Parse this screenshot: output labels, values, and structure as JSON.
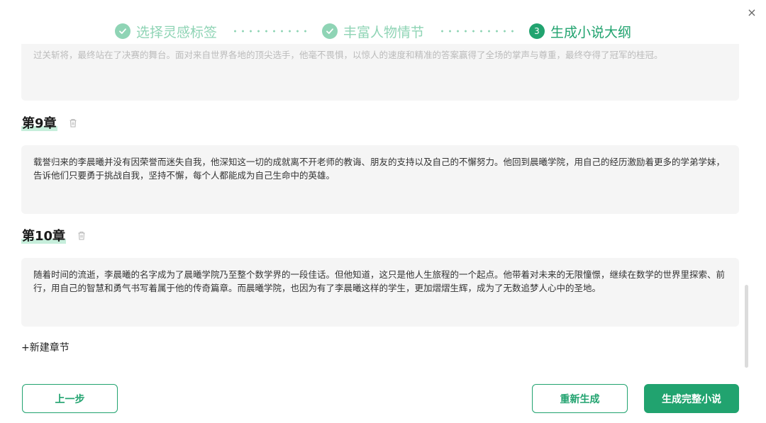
{
  "dialog": {
    "close_icon": "close-icon"
  },
  "steps": [
    {
      "label": "选择灵感标签",
      "state": "done",
      "icon": "check-circle-icon"
    },
    {
      "label": "丰富人物情节",
      "state": "done",
      "icon": "check-circle-icon"
    },
    {
      "number": "3",
      "label": "生成小说大纲",
      "state": "active"
    }
  ],
  "chapters": {
    "prev_text": "过关斩将，最终站在了决赛的舞台。面对来自世界各地的顶尖选手，他毫不畏惧，以惊人的速度和精准的答案赢得了全场的掌声与尊重，最终夺得了冠军的桂冠。",
    "items": [
      {
        "title": "第9章",
        "text": "载誉归来的李晨曦并没有因荣誉而迷失自我，他深知这一切的成就离不开老师的教诲、朋友的支持以及自己的不懈努力。他回到晨曦学院，用自己的经历激励着更多的学弟学妹，告诉他们只要勇于挑战自我，坚持不懈，每个人都能成为自己生命中的英雄。"
      },
      {
        "title": "第10章",
        "text": "随着时间的流逝，李晨曦的名字成为了晨曦学院乃至整个数学界的一段佳话。但他知道，这只是他人生旅程的一个起点。他带着对未来的无限憧憬，继续在数学的世界里探索、前行，用自己的智慧和勇气书写着属于他的传奇篇章。而晨曦学院，也因为有了李晨曦这样的学生，更加熠熠生辉，成为了无数追梦人心中的圣地。"
      }
    ],
    "add_label": "+新建章节"
  },
  "footer": {
    "prev_label": "上一步",
    "regenerate_label": "重新生成",
    "generate_full_label": "生成完整小说"
  },
  "colors": {
    "accent": "#21a36f",
    "done": "#8fd4b5",
    "card_bg": "#f5f5f5"
  }
}
